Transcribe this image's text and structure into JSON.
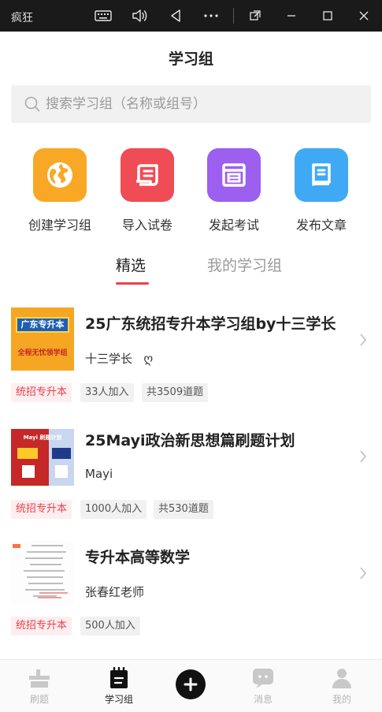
{
  "titlebar": {
    "app_name": "疯狂"
  },
  "header": {
    "title": "学习组"
  },
  "search": {
    "placeholder": "搜索学习组（名称或组号）"
  },
  "quick_actions": [
    {
      "label": "创建学习组",
      "icon": "globe-icon",
      "color": "#f9a825"
    },
    {
      "label": "导入试卷",
      "icon": "scroll-icon",
      "color": "#f04c55"
    },
    {
      "label": "发起考试",
      "icon": "exam-paper-icon",
      "color": "#9c5ff0"
    },
    {
      "label": "发布文章",
      "icon": "book-icon",
      "color": "#3fa9f5"
    }
  ],
  "tabs": [
    {
      "label": "精选",
      "active": true
    },
    {
      "label": "我的学习组",
      "active": false
    }
  ],
  "groups": [
    {
      "title": "25广东统招专升本学习组by十三学长",
      "author": "十三学长",
      "author_badge": "ღ",
      "cover_text_top": "广东专升本",
      "cover_text_bottom": "全程无忧领学组",
      "tags": [
        "统招专升本",
        "33人加入",
        "共3509道题"
      ]
    },
    {
      "title": "25Mayi政治新思想篇刷题计划",
      "author": "Mayi",
      "cover_text_top": "Mayi 刷题计划",
      "tags": [
        "统招专升本",
        "1000人加入",
        "共530道题"
      ]
    },
    {
      "title": "专升本高等数学",
      "author": "张春红老师",
      "tags": [
        "统招专升本",
        "500人加入"
      ]
    }
  ],
  "bottom_nav": [
    {
      "label": "刷题",
      "icon": "practice-icon",
      "active": false
    },
    {
      "label": "学习组",
      "icon": "study-group-icon",
      "active": true
    },
    {
      "label": "",
      "icon": "plus-icon",
      "active": false
    },
    {
      "label": "消息",
      "icon": "message-icon",
      "active": false
    },
    {
      "label": "我的",
      "icon": "profile-icon",
      "active": false
    }
  ],
  "colors": {
    "accent": "#e8434d",
    "tag_bg_pink": "#fdeef0",
    "tag_bg_gray": "#f1f1f1"
  }
}
